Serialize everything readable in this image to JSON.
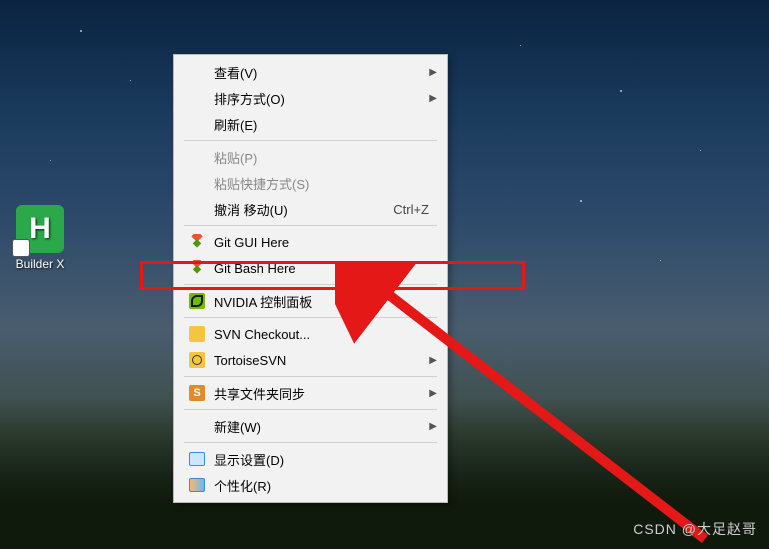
{
  "desktop": {
    "icon_letter": "H",
    "icon_label": "Builder X"
  },
  "menu": {
    "view": "查看(V)",
    "sort": "排序方式(O)",
    "refresh": "刷新(E)",
    "paste": "粘贴(P)",
    "paste_shortcut": "粘贴快捷方式(S)",
    "undo_move": "撤消 移动(U)",
    "undo_move_shortcut": "Ctrl+Z",
    "git_gui": "Git GUI Here",
    "git_bash": "Git Bash Here",
    "nvidia": "NVIDIA 控制面板",
    "svn_checkout": "SVN Checkout...",
    "tortoise_svn": "TortoiseSVN",
    "share_sync": "共享文件夹同步",
    "new": "新建(W)",
    "display_settings": "显示设置(D)",
    "personalize": "个性化(R)"
  },
  "watermark": "CSDN @大足赵哥",
  "annotation": {
    "highlighted_item": "git_bash"
  }
}
